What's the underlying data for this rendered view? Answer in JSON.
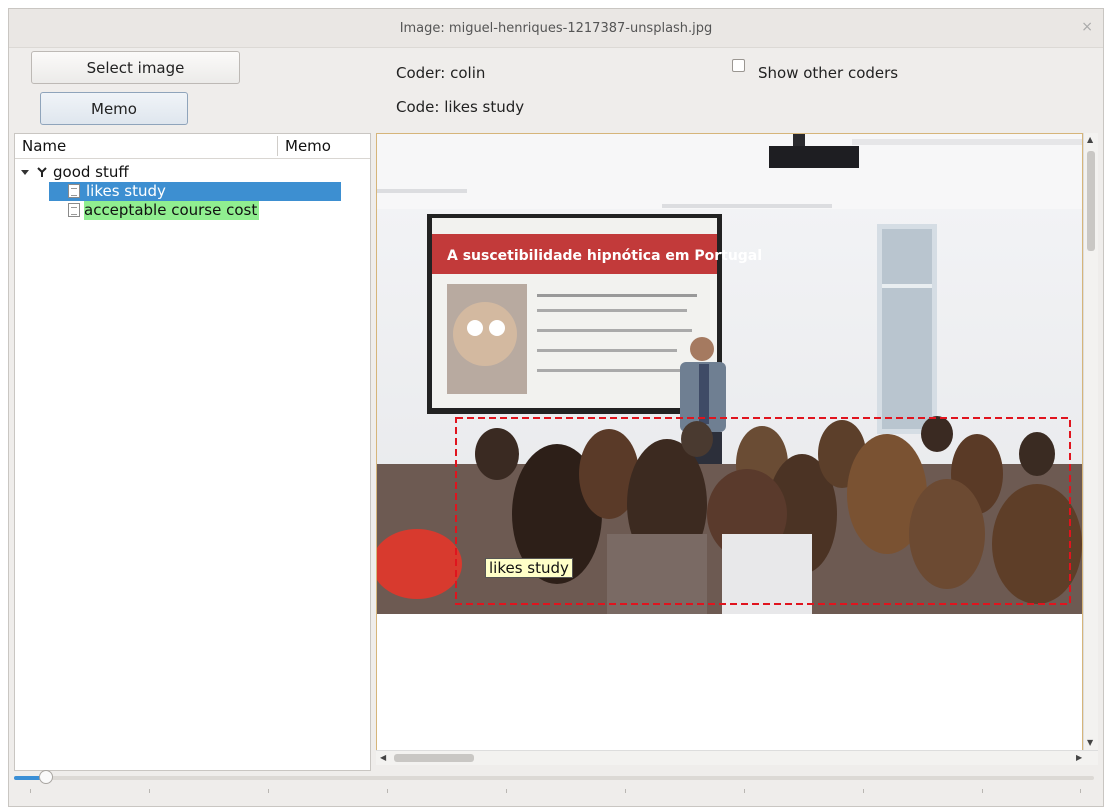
{
  "window": {
    "title": "Image: miguel-henriques-1217387-unsplash.jpg",
    "close_glyph": "×"
  },
  "buttons": {
    "select_image": "Select image",
    "memo": "Memo"
  },
  "info": {
    "coder": "Coder: colin",
    "code": "Code: likes study",
    "show_other_coders": "Show other coders",
    "show_other_coders_checked": false
  },
  "tree": {
    "columns": [
      "Name",
      "Memo"
    ],
    "category": "good stuff",
    "codes": [
      {
        "name": "likes study",
        "state": "selected",
        "color": "#3d8fd1"
      },
      {
        "name": "acceptable course cost",
        "state": "normal",
        "color": "#90ee90"
      }
    ]
  },
  "viewer": {
    "slide_title": "A suscetibilidade hipnótica em Portugal",
    "region_label": "likes study",
    "region_color": "#e0141e"
  },
  "zoom": {
    "level": 0.03
  }
}
